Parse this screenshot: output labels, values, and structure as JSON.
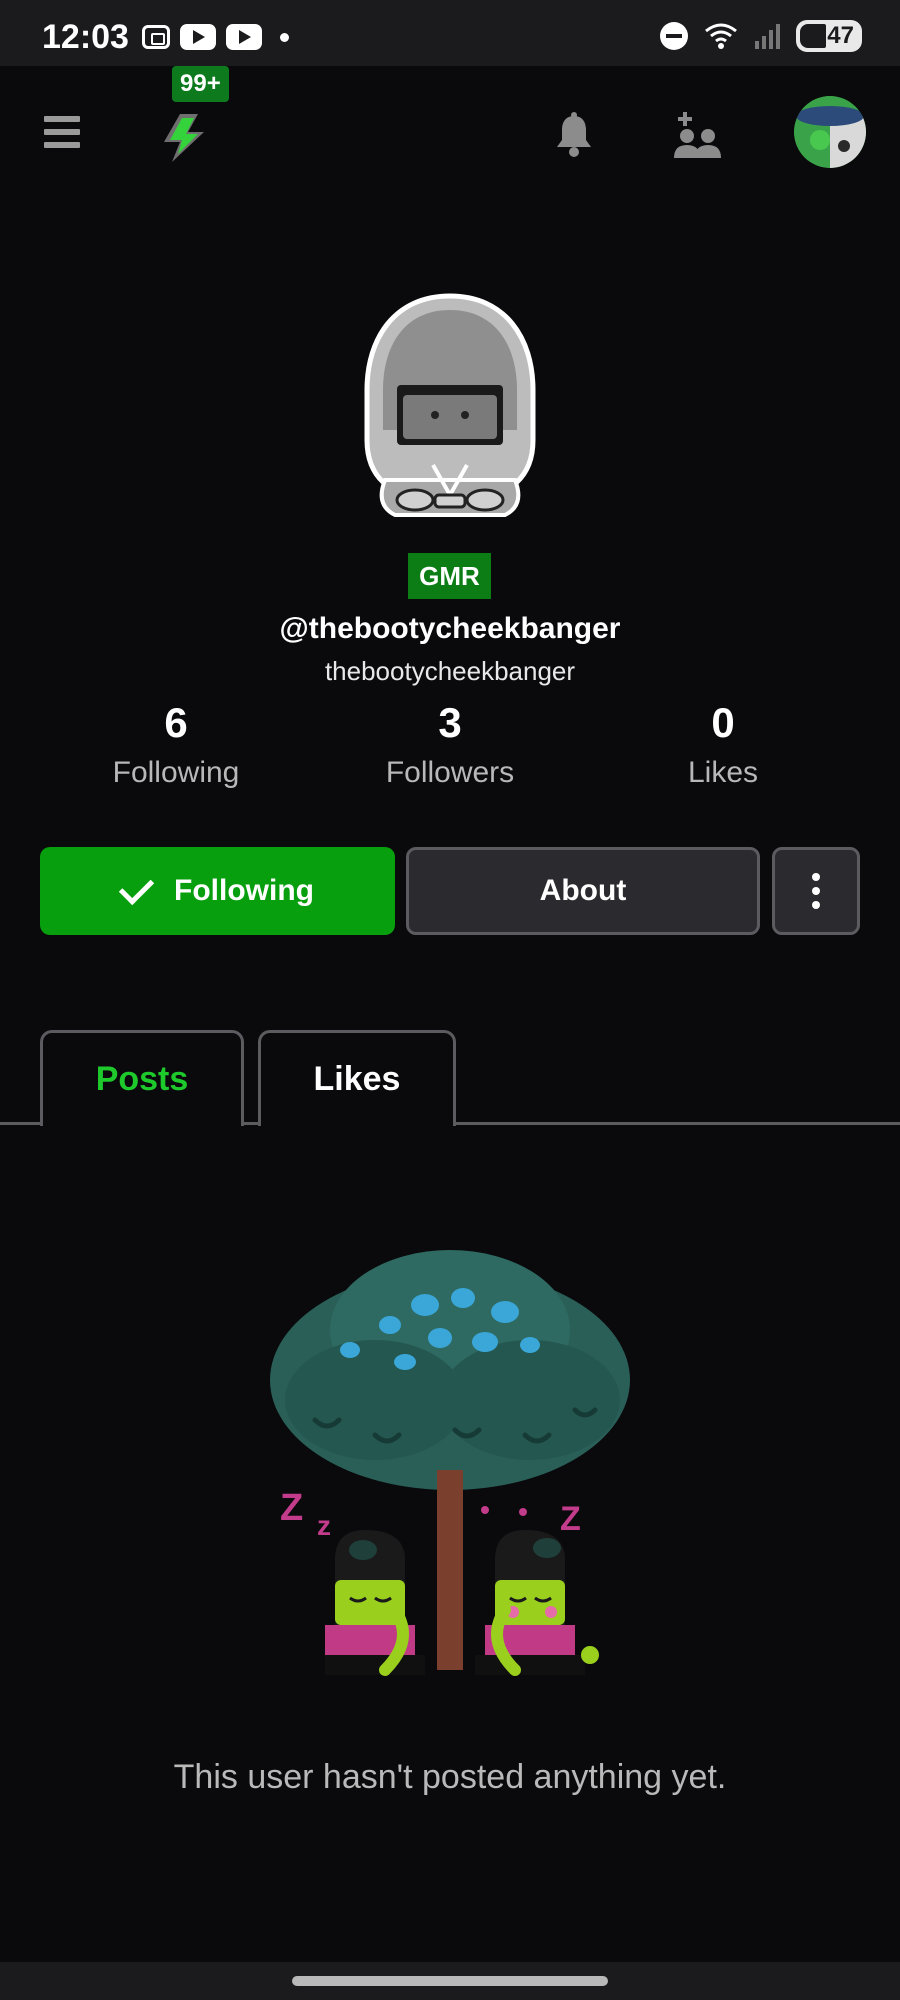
{
  "status_bar": {
    "time": "12:03",
    "battery": "47",
    "icons": [
      "screenshot-icon",
      "youtube-icon",
      "youtube-icon",
      "dot-icon",
      "dnd-icon",
      "wifi-icon",
      "signal-icon",
      "battery-icon"
    ]
  },
  "appbar": {
    "notification_badge": "99+",
    "icons": [
      "menu-icon",
      "lightning-icon",
      "bell-icon",
      "add-friend-icon",
      "profile-avatar-icon"
    ]
  },
  "profile": {
    "tag": "GMR",
    "handle": "@thebootycheekbanger",
    "display_name": "thebootycheekbanger",
    "stats": [
      {
        "value": "6",
        "label": "Following"
      },
      {
        "value": "3",
        "label": "Followers"
      },
      {
        "value": "0",
        "label": "Likes"
      }
    ]
  },
  "actions": {
    "follow_label": "Following",
    "about_label": "About"
  },
  "tabs": [
    {
      "label": "Posts",
      "active": true
    },
    {
      "label": "Likes",
      "active": false
    }
  ],
  "empty_state": {
    "message": "This user hasn't posted anything yet."
  },
  "colors": {
    "background": "#0a090c",
    "accent_green": "#079f0d",
    "tab_active": "#1ec92c",
    "tag_green": "#0b7d14"
  }
}
